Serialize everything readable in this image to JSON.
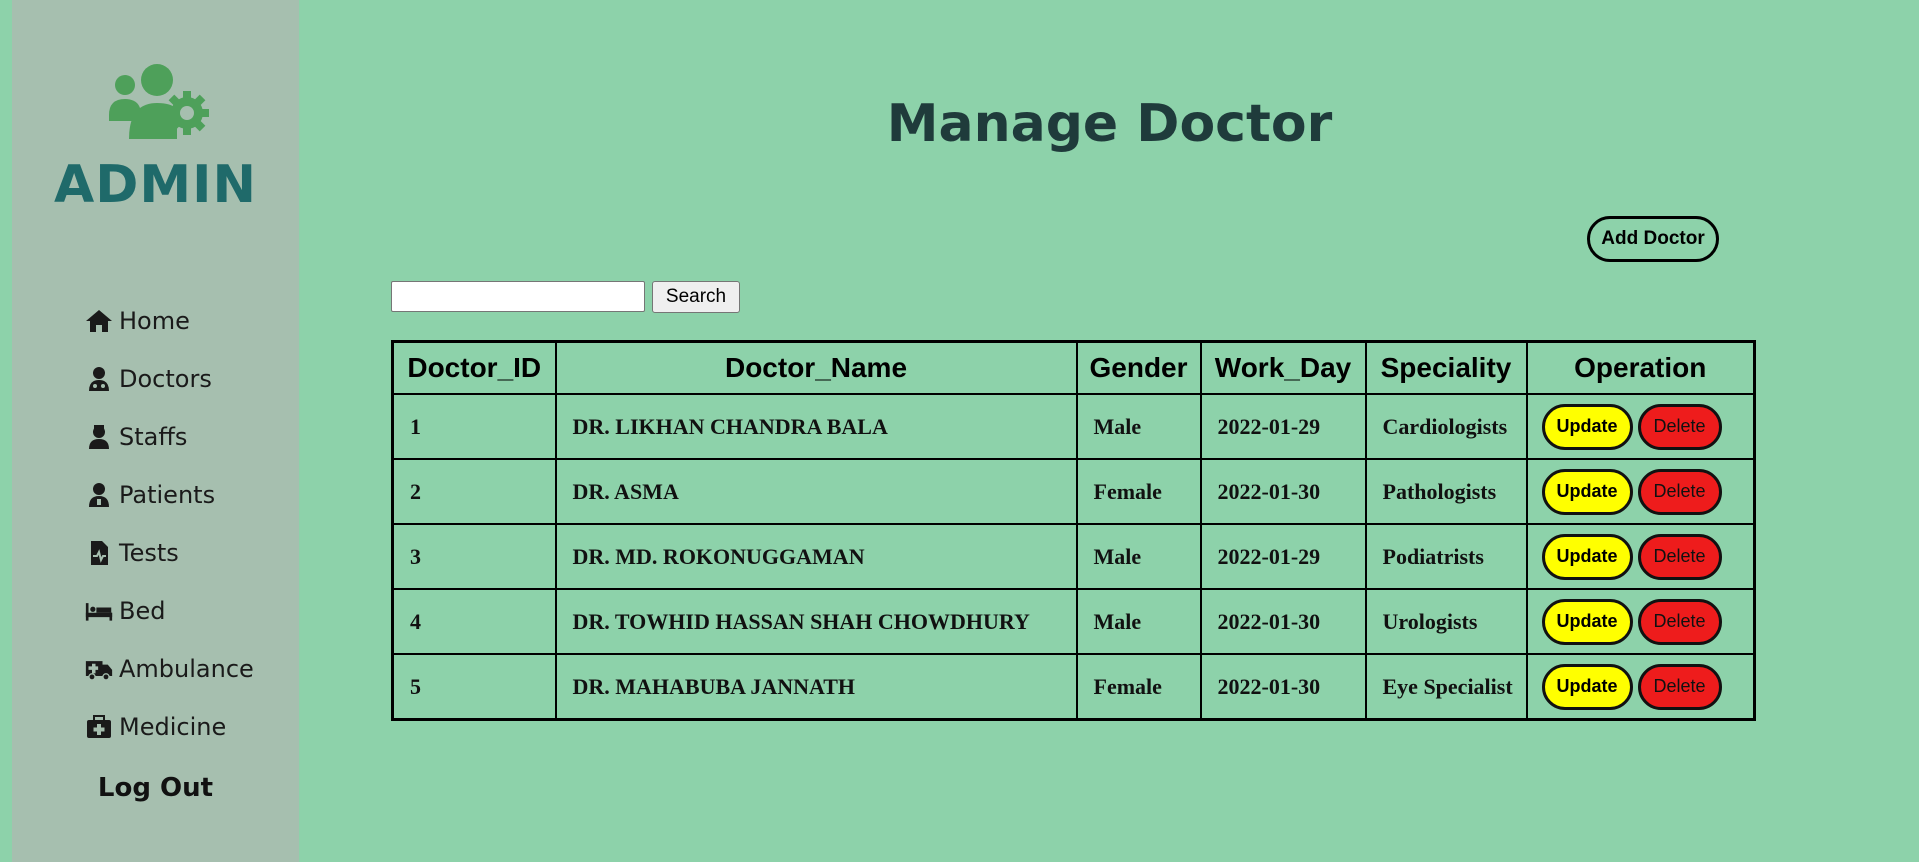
{
  "sidebar": {
    "title": "ADMIN",
    "items": [
      {
        "label": "Home",
        "icon": "home-icon"
      },
      {
        "label": "Doctors",
        "icon": "doctor-icon"
      },
      {
        "label": "Staffs",
        "icon": "staff-icon"
      },
      {
        "label": "Patients",
        "icon": "patient-icon"
      },
      {
        "label": "Tests",
        "icon": "file-medical-icon"
      },
      {
        "label": "Bed",
        "icon": "bed-icon"
      },
      {
        "label": "Ambulance",
        "icon": "ambulance-icon"
      },
      {
        "label": "Medicine",
        "icon": "medkit-icon"
      }
    ],
    "logout_label": "Log Out"
  },
  "header": {
    "title": "Manage Doctor",
    "add_label": "Add Doctor"
  },
  "search": {
    "value": "",
    "button_label": "Search"
  },
  "table": {
    "columns": [
      "Doctor_ID",
      "Doctor_Name",
      "Gender",
      "Work_Day",
      "Speciality",
      "Operation"
    ],
    "rows": [
      [
        "1",
        "DR. LIKHAN CHANDRA BALA",
        "Male",
        "2022-01-29",
        "Cardiologists"
      ],
      [
        "2",
        "DR. ASMA",
        "Female",
        "2022-01-30",
        "Pathologists"
      ],
      [
        "3",
        "DR. MD. ROKONUGGAMAN",
        "Male",
        "2022-01-29",
        "Podiatrists"
      ],
      [
        "4",
        "DR. TOWHID HASSAN SHAH CHOWDHURY",
        "Male",
        "2022-01-30",
        "Urologists"
      ],
      [
        "5",
        "DR. MAHABUBA JANNATH",
        "Female",
        "2022-01-30",
        "Eye Specialist"
      ]
    ],
    "update_label": "Update",
    "delete_label": "Delete"
  },
  "colors": {
    "background": "#8dd2aa",
    "sidebar": "#a6bfaf",
    "admin_text": "#1f6a6a",
    "logo": "#4ea05a",
    "update": "#ffff00",
    "delete": "#ee1c1c"
  }
}
